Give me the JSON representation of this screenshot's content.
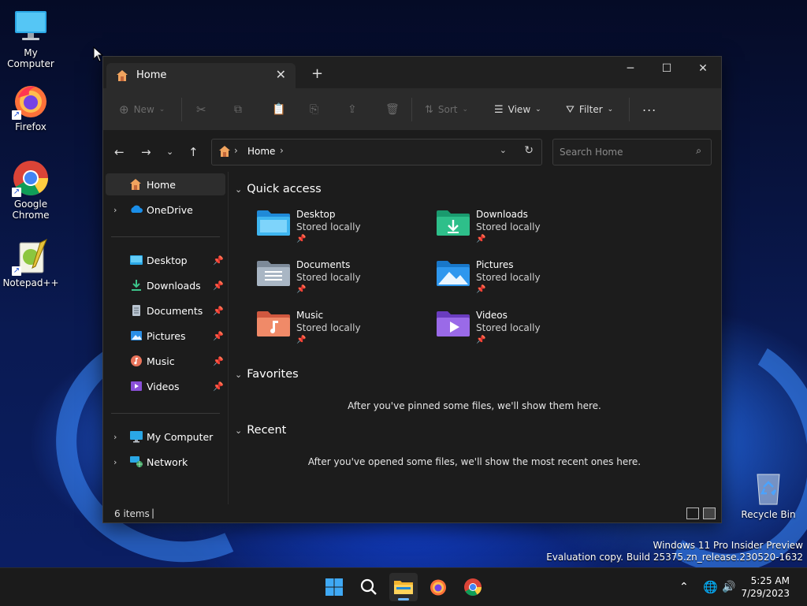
{
  "desktop": {
    "icons": [
      {
        "label": "My Computer"
      },
      {
        "label": "Firefox"
      },
      {
        "label": "Google Chrome"
      },
      {
        "label": "Notepad++"
      },
      {
        "label": "Recycle Bin"
      }
    ],
    "watermark": {
      "line1": "Windows 11 Pro Insider Preview",
      "line2": "Evaluation copy. Build 25375.zn_release.230520-1632"
    }
  },
  "explorer": {
    "tab_title": "Home",
    "toolbar": {
      "new": "New",
      "sort": "Sort",
      "view": "View",
      "filter": "Filter",
      "more": "..."
    },
    "address": {
      "crumb": "Home",
      "separator": "›"
    },
    "search": {
      "placeholder": "Search Home"
    },
    "sidebar": {
      "items": [
        {
          "label": "Home"
        },
        {
          "label": "OneDrive"
        },
        {
          "label": "Desktop"
        },
        {
          "label": "Downloads"
        },
        {
          "label": "Documents"
        },
        {
          "label": "Pictures"
        },
        {
          "label": "Music"
        },
        {
          "label": "Videos"
        },
        {
          "label": "My Computer"
        },
        {
          "label": "Network"
        }
      ]
    },
    "quick_access": {
      "heading": "Quick access",
      "items": [
        {
          "name": "Desktop",
          "location": "Stored locally"
        },
        {
          "name": "Downloads",
          "location": "Stored locally"
        },
        {
          "name": "Documents",
          "location": "Stored locally"
        },
        {
          "name": "Pictures",
          "location": "Stored locally"
        },
        {
          "name": "Music",
          "location": "Stored locally"
        },
        {
          "name": "Videos",
          "location": "Stored locally"
        }
      ]
    },
    "favorites": {
      "heading": "Favorites",
      "empty": "After you've pinned some files, we'll show them here."
    },
    "recent": {
      "heading": "Recent",
      "empty": "After you've opened some files, we'll show the most recent ones here."
    },
    "status": {
      "items": "6 items"
    }
  },
  "taskbar": {
    "time": "5:25 AM",
    "date": "7/29/2023"
  },
  "colors": {
    "accent": "#4cc2ff",
    "window_bg": "#1c1c1c",
    "toolbar_bg": "#2b2b2b",
    "taskbar_bg": "#1b1b1b"
  }
}
